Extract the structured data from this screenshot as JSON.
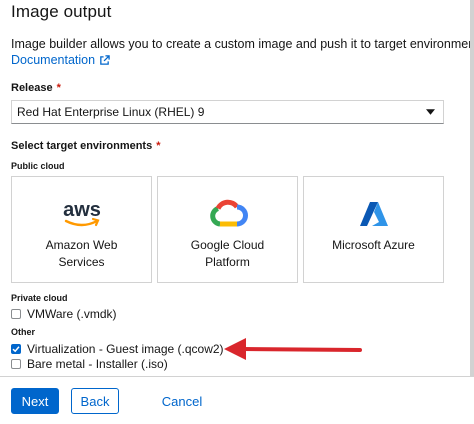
{
  "header": {
    "title": "Image output",
    "description": "Image builder allows you to create a custom image and push it to target environments.",
    "documentation_link": "Documentation"
  },
  "release": {
    "label": "Release",
    "required_mark": "*",
    "selected": "Red Hat Enterprise Linux (RHEL) 9"
  },
  "targets": {
    "label": "Select target environments",
    "required_mark": "*",
    "public_cloud_label": "Public cloud",
    "tiles": [
      {
        "line1": "Amazon Web",
        "line2": "Services",
        "logo_text": "aws",
        "icon": "aws-logo-icon"
      },
      {
        "line1": "Google Cloud",
        "line2": "Platform",
        "icon": "google-cloud-logo-icon"
      },
      {
        "line1": "Microsoft Azure",
        "line2": "",
        "icon": "azure-logo-icon"
      }
    ],
    "private_cloud_label": "Private cloud",
    "private_options": [
      {
        "label": "VMWare (.vmdk)",
        "checked": false
      }
    ],
    "other_label": "Other",
    "other_options": [
      {
        "label": "Virtualization - Guest image (.qcow2)",
        "checked": true
      },
      {
        "label": "Bare metal - Installer (.iso)",
        "checked": false
      }
    ]
  },
  "footer": {
    "next_label": "Next",
    "back_label": "Back",
    "cancel_label": "Cancel"
  },
  "colors": {
    "link": "#0066cc",
    "required": "#c9190b",
    "annotation_arrow": "#d9262c",
    "aws_orange": "#ff9900",
    "azure_blue": "#0078d4"
  }
}
